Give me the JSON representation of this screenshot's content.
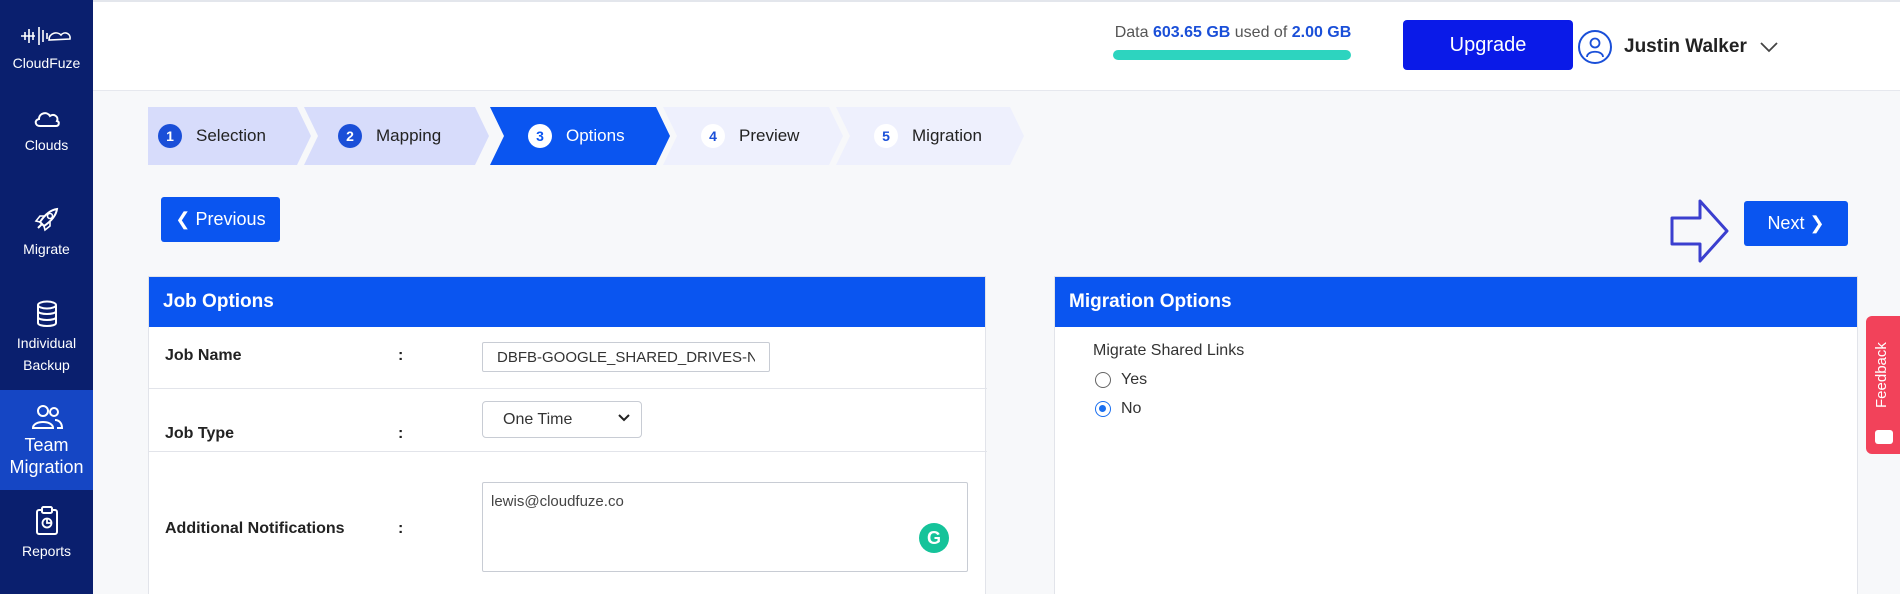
{
  "sidebar": {
    "logo_label": "CloudFuze",
    "items": [
      {
        "label": "Clouds",
        "icon": "cloud-icon"
      },
      {
        "label": "Migrate",
        "icon": "rocket-icon"
      },
      {
        "label": "Individual Backup",
        "icon": "database-icon"
      },
      {
        "label": "Team Migration",
        "icon": "users-icon"
      },
      {
        "label": "Reports",
        "icon": "clipboard-icon"
      }
    ]
  },
  "header": {
    "storage_prefix": "Data",
    "storage_used": "603.65 GB",
    "storage_mid": "used of",
    "storage_total": "2.00 GB",
    "storage_bar_fraction": 1.0,
    "upgrade_label": "Upgrade",
    "user_name": "Justin Walker"
  },
  "stepper": {
    "steps": [
      {
        "num": "1",
        "label": "Selection",
        "state": "done"
      },
      {
        "num": "2",
        "label": "Mapping",
        "state": "done"
      },
      {
        "num": "3",
        "label": "Options",
        "state": "active"
      },
      {
        "num": "4",
        "label": "Preview",
        "state": "pending"
      },
      {
        "num": "5",
        "label": "Migration",
        "state": "pending"
      }
    ]
  },
  "nav": {
    "previous_label": "Previous",
    "next_label": "Next"
  },
  "job_options": {
    "title": "Job Options",
    "job_name_label": "Job Name",
    "job_name_value": "DBFB-GOOGLE_SHARED_DRIVES-N(",
    "job_type_label": "Job Type",
    "job_type_value": "One Time",
    "notifications_label": "Additional Notifications",
    "notifications_value": "lewis@cloudfuze.co",
    "colon": ":"
  },
  "migration_options": {
    "title": "Migration Options",
    "shared_links_label": "Migrate Shared Links",
    "yes_label": "Yes",
    "no_label": "No",
    "selected": "No"
  },
  "feedback_label": "Feedback",
  "colors": {
    "sidebar_bg": "#0a1f6e",
    "accent": "#0a55f0",
    "upgrade": "#0a1ae8",
    "storage_bar": "#2dd4bf",
    "feedback": "#f2425a"
  }
}
